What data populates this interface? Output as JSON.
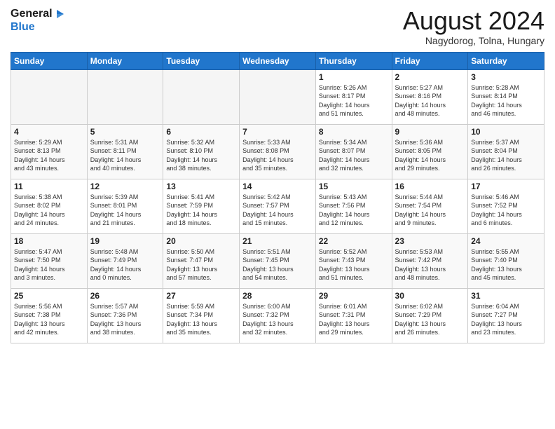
{
  "logo": {
    "text_general": "General",
    "text_blue": "Blue"
  },
  "header": {
    "month_year": "August 2024",
    "location": "Nagydorog, Tolna, Hungary"
  },
  "weekdays": [
    "Sunday",
    "Monday",
    "Tuesday",
    "Wednesday",
    "Thursday",
    "Friday",
    "Saturday"
  ],
  "weeks": [
    [
      {
        "day": "",
        "info": ""
      },
      {
        "day": "",
        "info": ""
      },
      {
        "day": "",
        "info": ""
      },
      {
        "day": "",
        "info": ""
      },
      {
        "day": "1",
        "info": "Sunrise: 5:26 AM\nSunset: 8:17 PM\nDaylight: 14 hours\nand 51 minutes."
      },
      {
        "day": "2",
        "info": "Sunrise: 5:27 AM\nSunset: 8:16 PM\nDaylight: 14 hours\nand 48 minutes."
      },
      {
        "day": "3",
        "info": "Sunrise: 5:28 AM\nSunset: 8:14 PM\nDaylight: 14 hours\nand 46 minutes."
      }
    ],
    [
      {
        "day": "4",
        "info": "Sunrise: 5:29 AM\nSunset: 8:13 PM\nDaylight: 14 hours\nand 43 minutes."
      },
      {
        "day": "5",
        "info": "Sunrise: 5:31 AM\nSunset: 8:11 PM\nDaylight: 14 hours\nand 40 minutes."
      },
      {
        "day": "6",
        "info": "Sunrise: 5:32 AM\nSunset: 8:10 PM\nDaylight: 14 hours\nand 38 minutes."
      },
      {
        "day": "7",
        "info": "Sunrise: 5:33 AM\nSunset: 8:08 PM\nDaylight: 14 hours\nand 35 minutes."
      },
      {
        "day": "8",
        "info": "Sunrise: 5:34 AM\nSunset: 8:07 PM\nDaylight: 14 hours\nand 32 minutes."
      },
      {
        "day": "9",
        "info": "Sunrise: 5:36 AM\nSunset: 8:05 PM\nDaylight: 14 hours\nand 29 minutes."
      },
      {
        "day": "10",
        "info": "Sunrise: 5:37 AM\nSunset: 8:04 PM\nDaylight: 14 hours\nand 26 minutes."
      }
    ],
    [
      {
        "day": "11",
        "info": "Sunrise: 5:38 AM\nSunset: 8:02 PM\nDaylight: 14 hours\nand 24 minutes."
      },
      {
        "day": "12",
        "info": "Sunrise: 5:39 AM\nSunset: 8:01 PM\nDaylight: 14 hours\nand 21 minutes."
      },
      {
        "day": "13",
        "info": "Sunrise: 5:41 AM\nSunset: 7:59 PM\nDaylight: 14 hours\nand 18 minutes."
      },
      {
        "day": "14",
        "info": "Sunrise: 5:42 AM\nSunset: 7:57 PM\nDaylight: 14 hours\nand 15 minutes."
      },
      {
        "day": "15",
        "info": "Sunrise: 5:43 AM\nSunset: 7:56 PM\nDaylight: 14 hours\nand 12 minutes."
      },
      {
        "day": "16",
        "info": "Sunrise: 5:44 AM\nSunset: 7:54 PM\nDaylight: 14 hours\nand 9 minutes."
      },
      {
        "day": "17",
        "info": "Sunrise: 5:46 AM\nSunset: 7:52 PM\nDaylight: 14 hours\nand 6 minutes."
      }
    ],
    [
      {
        "day": "18",
        "info": "Sunrise: 5:47 AM\nSunset: 7:50 PM\nDaylight: 14 hours\nand 3 minutes."
      },
      {
        "day": "19",
        "info": "Sunrise: 5:48 AM\nSunset: 7:49 PM\nDaylight: 14 hours\nand 0 minutes."
      },
      {
        "day": "20",
        "info": "Sunrise: 5:50 AM\nSunset: 7:47 PM\nDaylight: 13 hours\nand 57 minutes."
      },
      {
        "day": "21",
        "info": "Sunrise: 5:51 AM\nSunset: 7:45 PM\nDaylight: 13 hours\nand 54 minutes."
      },
      {
        "day": "22",
        "info": "Sunrise: 5:52 AM\nSunset: 7:43 PM\nDaylight: 13 hours\nand 51 minutes."
      },
      {
        "day": "23",
        "info": "Sunrise: 5:53 AM\nSunset: 7:42 PM\nDaylight: 13 hours\nand 48 minutes."
      },
      {
        "day": "24",
        "info": "Sunrise: 5:55 AM\nSunset: 7:40 PM\nDaylight: 13 hours\nand 45 minutes."
      }
    ],
    [
      {
        "day": "25",
        "info": "Sunrise: 5:56 AM\nSunset: 7:38 PM\nDaylight: 13 hours\nand 42 minutes."
      },
      {
        "day": "26",
        "info": "Sunrise: 5:57 AM\nSunset: 7:36 PM\nDaylight: 13 hours\nand 38 minutes."
      },
      {
        "day": "27",
        "info": "Sunrise: 5:59 AM\nSunset: 7:34 PM\nDaylight: 13 hours\nand 35 minutes."
      },
      {
        "day": "28",
        "info": "Sunrise: 6:00 AM\nSunset: 7:32 PM\nDaylight: 13 hours\nand 32 minutes."
      },
      {
        "day": "29",
        "info": "Sunrise: 6:01 AM\nSunset: 7:31 PM\nDaylight: 13 hours\nand 29 minutes."
      },
      {
        "day": "30",
        "info": "Sunrise: 6:02 AM\nSunset: 7:29 PM\nDaylight: 13 hours\nand 26 minutes."
      },
      {
        "day": "31",
        "info": "Sunrise: 6:04 AM\nSunset: 7:27 PM\nDaylight: 13 hours\nand 23 minutes."
      }
    ]
  ]
}
